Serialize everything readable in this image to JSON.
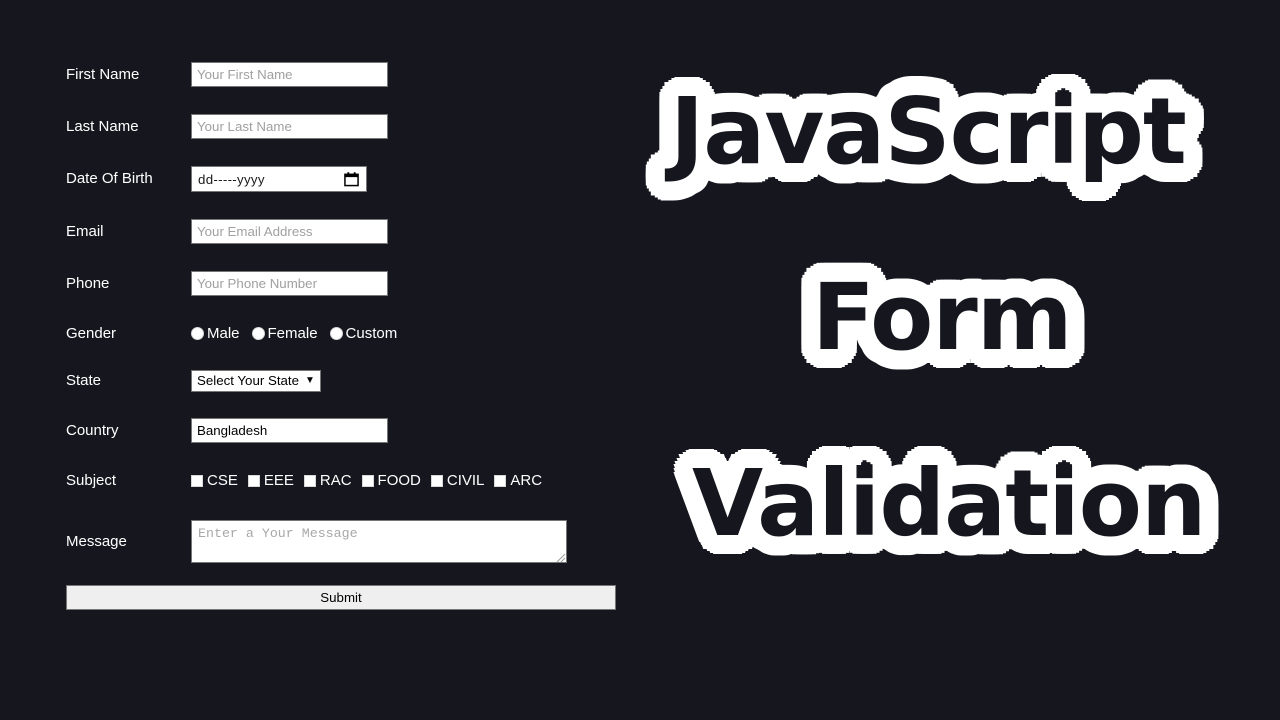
{
  "theme": {
    "background": "#16161f",
    "label_color": "#ffffff",
    "input_background": "#ffffff",
    "placeholder_color": "#a0a0a0",
    "title_fill": "#16161f",
    "title_outline": "#ffffff",
    "button_background": "#efefef"
  },
  "form": {
    "fields": {
      "first_name": {
        "label": "First Name",
        "placeholder": "Your First Name",
        "value": ""
      },
      "last_name": {
        "label": "Last Name",
        "placeholder": "Your Last Name",
        "value": ""
      },
      "date_of_birth": {
        "label": "Date Of Birth",
        "display": "dd-----yyyy",
        "icon": "calendar-icon"
      },
      "email": {
        "label": "Email",
        "placeholder": "Your Email Address",
        "value": ""
      },
      "phone": {
        "label": "Phone",
        "placeholder": "Your Phone Number",
        "value": ""
      },
      "gender": {
        "label": "Gender",
        "options": [
          {
            "label": "Male",
            "checked": false
          },
          {
            "label": "Female",
            "checked": false
          },
          {
            "label": "Custom",
            "checked": false
          }
        ]
      },
      "state": {
        "label": "State",
        "selected": "Select Your State"
      },
      "country": {
        "label": "Country",
        "value": "Bangladesh"
      },
      "subject": {
        "label": "Subject",
        "options": [
          {
            "label": "CSE",
            "checked": false
          },
          {
            "label": "EEE",
            "checked": false
          },
          {
            "label": "RAC",
            "checked": false
          },
          {
            "label": "FOOD",
            "checked": false
          },
          {
            "label": "CIVIL",
            "checked": false
          },
          {
            "label": "ARC",
            "checked": false
          }
        ]
      },
      "message": {
        "label": "Message",
        "placeholder": "Enter a Your Message"
      }
    },
    "submit_label": "Submit"
  },
  "title": {
    "line1": "JavaScript",
    "line2": "Form",
    "line3": "Validation"
  }
}
